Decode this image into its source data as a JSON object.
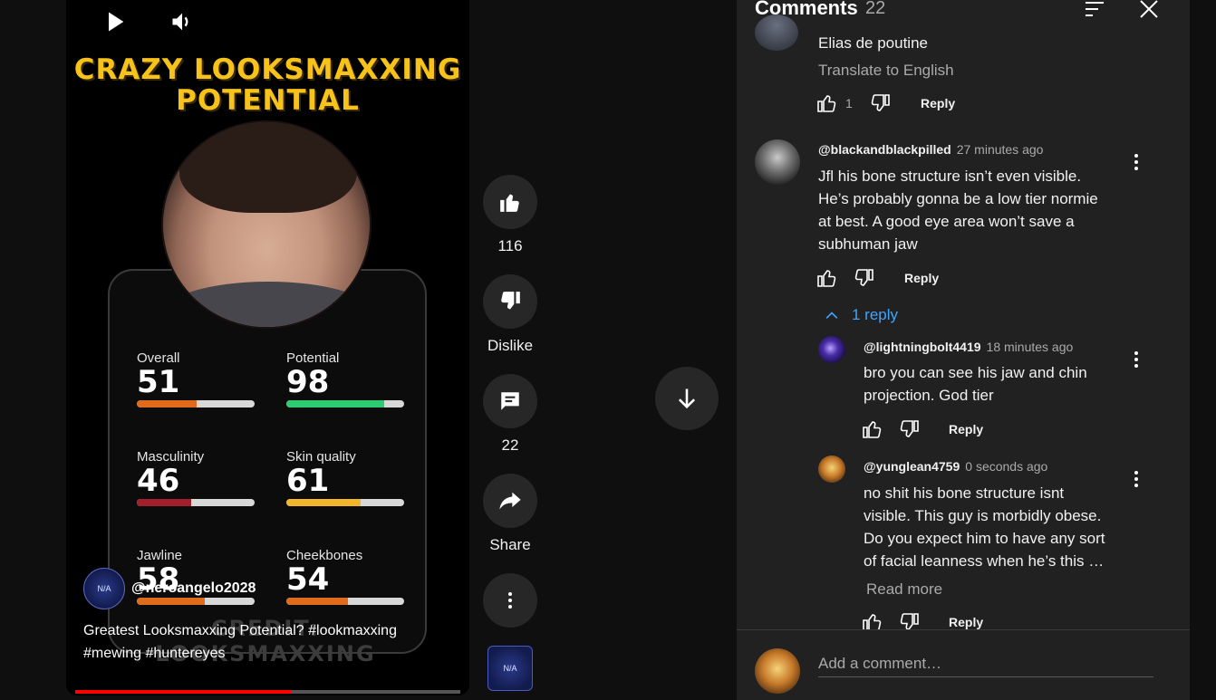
{
  "video": {
    "title_line1": "CRAZY LOOKSMAXXING",
    "title_line2": "POTENTIAL",
    "stats": [
      {
        "label": "Overall",
        "value": "51",
        "fill": 0.51,
        "color": "#e16b1c"
      },
      {
        "label": "Potential",
        "value": "98",
        "fill": 0.83,
        "color": "#2ecc71"
      },
      {
        "label": "Masculinity",
        "value": "46",
        "fill": 0.46,
        "color": "#a2202e"
      },
      {
        "label": "Skin quality",
        "value": "61",
        "fill": 0.63,
        "color": "#f1b62a"
      },
      {
        "label": "Jawline",
        "value": "58",
        "fill": 0.58,
        "color": "#e16b1c"
      },
      {
        "label": "Cheekbones",
        "value": "54",
        "fill": 0.52,
        "color": "#e16b1c"
      }
    ],
    "credit": "CREDIT: LOOKSMAXXING",
    "channel_name": "@neroangelo2028",
    "channel_badge": "N/A",
    "caption_line1": "Greatest Looksmaxxing Potential? #lookmaxxing",
    "caption_line2": "#mewing #huntereyes",
    "progress": 0.56
  },
  "actions": {
    "like_count": "116",
    "dislike_label": "Dislike",
    "comment_count": "22",
    "share_label": "Share"
  },
  "panel": {
    "title": "Comments",
    "count": "22"
  },
  "comments": [
    {
      "author": "Elias de poutine",
      "translate": "Translate to English",
      "likes": "1",
      "reply": "Reply"
    },
    {
      "author": "@blackandblackpilled",
      "time": "27 minutes ago",
      "text": [
        "Jfl his bone structure isn’t even visible.",
        "He’s probably gonna be a low tier normie",
        "at best. A good eye area won’t save a",
        "subhuman jaw"
      ],
      "reply": "Reply",
      "replies_toggle": "1 reply"
    },
    {
      "author": "@lightningbolt4419",
      "time": "18 minutes ago",
      "text": [
        "bro you can see his jaw and chin",
        "projection. God tier"
      ],
      "reply": "Reply"
    },
    {
      "author": "@yunglean4759",
      "time": "0 seconds ago",
      "text": [
        "no shit his bone structure isnt",
        "visible. This guy is morbidly obese.",
        "Do you expect him to have any sort",
        "of facial leanness when he’s this …"
      ],
      "read_more": "Read more",
      "reply": "Reply"
    }
  ],
  "add_comment": {
    "placeholder": "Add a comment…"
  },
  "icons": {
    "play": "play-icon",
    "volume": "volume-icon",
    "like": "thumb-up-icon",
    "dislike": "thumb-down-icon",
    "comment": "comment-icon",
    "share": "share-icon",
    "more": "more-vert-icon",
    "down": "arrow-down-icon",
    "sort": "sort-icon",
    "close": "close-icon"
  },
  "colors": {
    "accent_blue": "#3ea6ff",
    "progress_red": "#ff0000",
    "title_yellow": "#f7c21a"
  }
}
